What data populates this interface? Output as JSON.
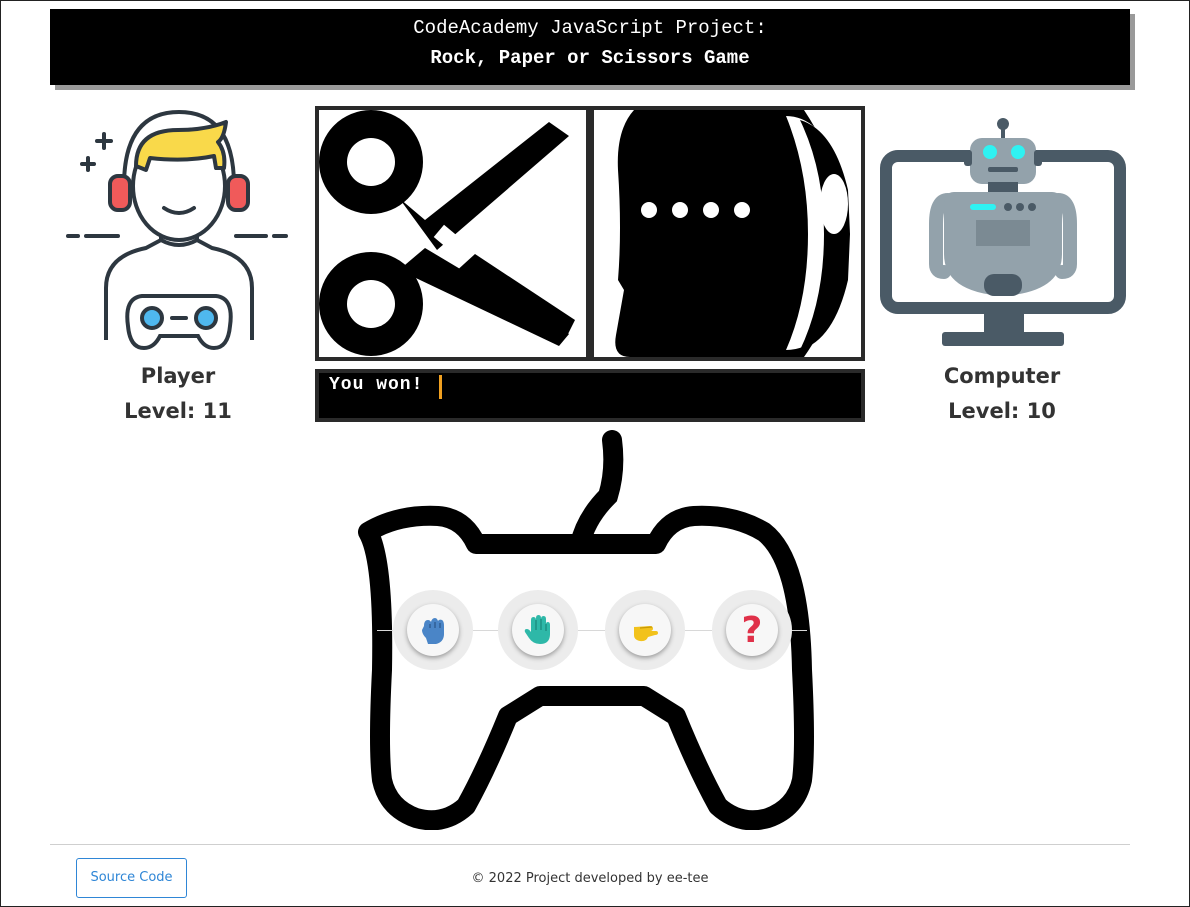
{
  "header": {
    "line1": "CodeAcademy JavaScript Project:",
    "line2": "Rock, Paper or Scissors Game"
  },
  "player": {
    "name": "Player",
    "level": "Level: 11"
  },
  "computer": {
    "name": "Computer",
    "level": "Level: 10"
  },
  "choices": {
    "player_choice": "scissors-icon",
    "computer_choice": "paper-roll-icon"
  },
  "result": {
    "text": "You won!"
  },
  "controls": [
    {
      "name": "rock-button",
      "icon": "fist-icon"
    },
    {
      "name": "paper-button",
      "icon": "open-hand-icon"
    },
    {
      "name": "scissors-button",
      "icon": "victory-hand-icon"
    },
    {
      "name": "random-button",
      "icon": "question-icon",
      "label": "?"
    }
  ],
  "footer": {
    "source_label": "Source Code",
    "copyright": "© 2022 Project developed by ee-tee"
  },
  "colors": {
    "header_bg": "#000000",
    "accent_blue": "#2f86d6",
    "question_red": "#e03149",
    "cursor": "#f0a020"
  }
}
